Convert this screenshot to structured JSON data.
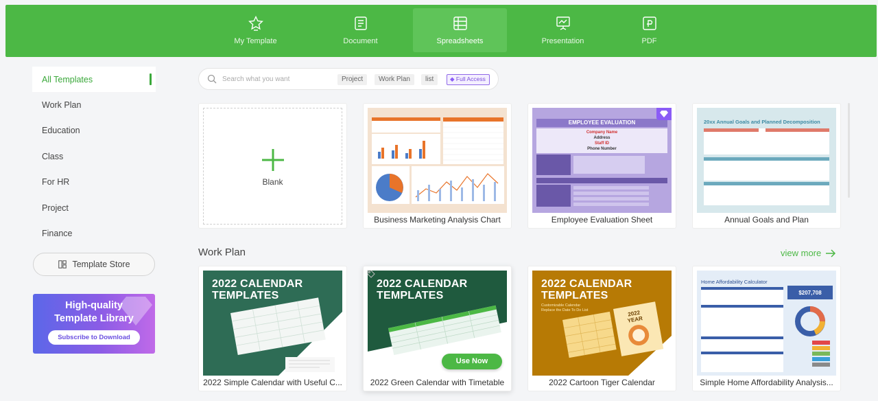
{
  "topbar": {
    "tabs": [
      {
        "label": "My Template",
        "icon": "star-icon"
      },
      {
        "label": "Document",
        "icon": "document-icon"
      },
      {
        "label": "Spreadsheets",
        "icon": "spreadsheet-icon",
        "active": true
      },
      {
        "label": "Presentation",
        "icon": "presentation-icon"
      },
      {
        "label": "PDF",
        "icon": "pdf-icon"
      }
    ]
  },
  "sidebar": {
    "items": [
      {
        "label": "All Templates",
        "active": true
      },
      {
        "label": "Work Plan"
      },
      {
        "label": "Education"
      },
      {
        "label": "Class"
      },
      {
        "label": "For HR"
      },
      {
        "label": "Project"
      },
      {
        "label": "Finance"
      }
    ],
    "store_button": "Template Store",
    "promo": {
      "line1": "High-quality",
      "line2": "Template Library",
      "button": "Subscribe to Download"
    }
  },
  "search": {
    "placeholder": "Search what you want",
    "chips": [
      "Project",
      "Work Plan",
      "list"
    ],
    "vip_chip": "Full Access"
  },
  "featured": {
    "blank_label": "Blank",
    "cards": [
      {
        "caption": "Business Marketing Analysis Chart"
      },
      {
        "caption": "Employee Evaluation Sheet",
        "thumb_heading": "EMPLOYEE EVALUATION",
        "thumb_fields": [
          "Company Name",
          "Address",
          "Staff ID",
          "Phone Number"
        ]
      },
      {
        "caption": "Annual Goals and Plan",
        "thumb_heading": "20xx Annual Goals and Planned Decomposition"
      }
    ]
  },
  "work_plan": {
    "title": "Work Plan",
    "view_more": "view more",
    "cards": [
      {
        "caption": "2022 Simple Calendar with Useful C...",
        "thumb_title": "2022 CALENDAR TEMPLATES"
      },
      {
        "caption": "2022 Green Calendar with Timetable",
        "thumb_title": "2022 CALENDAR TEMPLATES",
        "button": "Use Now"
      },
      {
        "caption": "2022 Cartoon Tiger Calendar",
        "thumb_title": "2022 CALENDAR TEMPLATES",
        "thumb_sub": "Customizable Calendar Replace the Date To Do List",
        "thumb_year": "2022 YEAR"
      },
      {
        "caption": "Simple Home Affordability Analysis...",
        "thumb_heading": "Home Affordability Calculator",
        "thumb_value": "$207,708"
      }
    ]
  },
  "colors": {
    "brand_green": "#4cb845",
    "vip_purple": "#8b5cf6"
  }
}
